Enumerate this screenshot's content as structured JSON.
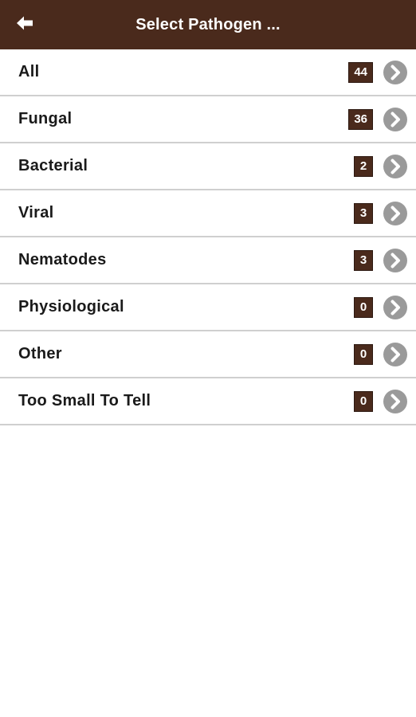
{
  "header": {
    "title": "Select Pathogen ...",
    "back_icon": "back-arrow-icon"
  },
  "colors": {
    "navbar": "#4a2a1c",
    "badge": "#4a2a1c",
    "chevron": "#9a9a9a"
  },
  "list": {
    "items": [
      {
        "label": "All",
        "count": "44",
        "id": "all"
      },
      {
        "label": "Fungal",
        "count": "36",
        "id": "fungal"
      },
      {
        "label": "Bacterial",
        "count": "2",
        "id": "bacterial"
      },
      {
        "label": "Viral",
        "count": "3",
        "id": "viral"
      },
      {
        "label": "Nematodes",
        "count": "3",
        "id": "nematodes"
      },
      {
        "label": "Physiological",
        "count": "0",
        "id": "physiological"
      },
      {
        "label": "Other",
        "count": "0",
        "id": "other"
      },
      {
        "label": "Too Small To Tell",
        "count": "0",
        "id": "too-small-to-tell"
      }
    ],
    "disclosure_icon": "chevron-right-circle-icon"
  }
}
